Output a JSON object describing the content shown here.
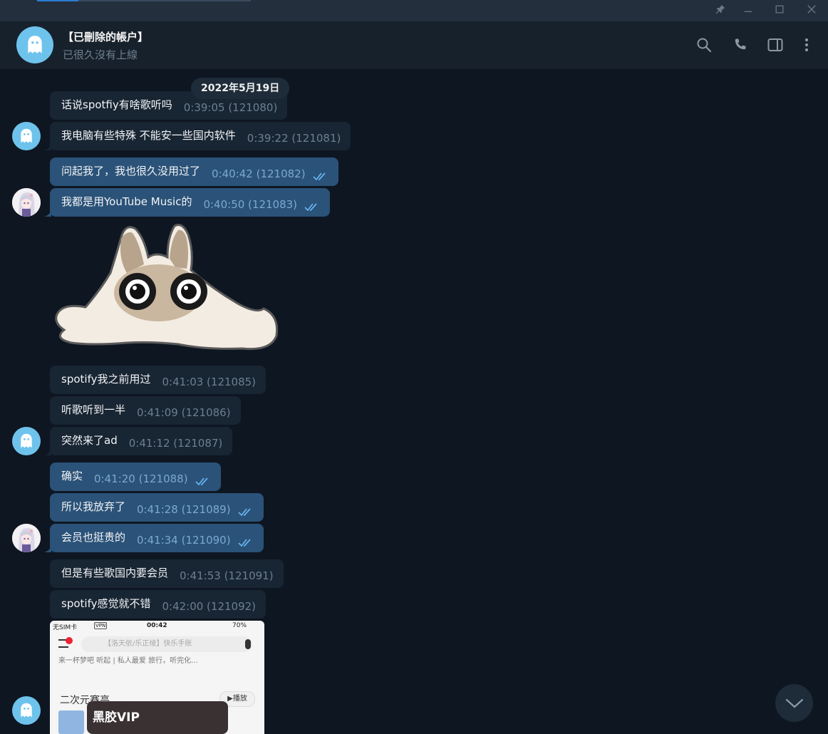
{
  "window": {
    "controls": [
      "pin-icon",
      "minimize-icon",
      "maximize-icon",
      "close-icon"
    ]
  },
  "header": {
    "title": "【已刪除的帳户】",
    "status": "已很久沒有上線",
    "icons": [
      "search-icon",
      "phone-icon",
      "sidebar-toggle-icon",
      "more-vertical-icon"
    ]
  },
  "date_label": "2022年5月19日",
  "messages": [
    {
      "dir": "in",
      "text": "话说spotfiy有啥歌听吗",
      "meta": "0:39:05 (121080)"
    },
    {
      "dir": "in",
      "text": "我电脑有些特殊 不能安一些国内软件",
      "meta": "0:39:22 (121081)"
    },
    {
      "dir": "out",
      "text": "问起我了，我也很久没用过了",
      "meta": "0:40:42 (121082)"
    },
    {
      "dir": "out",
      "text": "我都是用YouTube Music的",
      "meta": "0:40:50 (121083)"
    },
    {
      "dir": "in",
      "text": "spotify我之前用过",
      "meta": "0:41:03 (121085)"
    },
    {
      "dir": "in",
      "text": "听歌听到一半",
      "meta": "0:41:09 (121086)"
    },
    {
      "dir": "in",
      "text": "突然来了ad",
      "meta": "0:41:12 (121087)"
    },
    {
      "dir": "out",
      "text": "确实",
      "meta": "0:41:20 (121088)"
    },
    {
      "dir": "out",
      "text": "所以我放弃了",
      "meta": "0:41:28 (121089)"
    },
    {
      "dir": "out",
      "text": "会员也挺贵的",
      "meta": "0:41:34 (121090)"
    },
    {
      "dir": "in",
      "text": "但是有些歌国内要会员",
      "meta": "0:41:53 (121091)"
    },
    {
      "dir": "in",
      "text": "spotify感觉就不错",
      "meta": "0:42:00 (121092)"
    }
  ],
  "sticker": {
    "icon": "cat-blob-sticker"
  },
  "screenshot": {
    "carrier": "无SIM卡",
    "vpn": "VPN",
    "time": "00:42",
    "battery": "70%",
    "search_placeholder": "【洛天依/乐正绫】快乐手账",
    "row_text": "来一杯梦吧    听起 | 私人最爱    旅行，听完化...",
    "section_title": "二次元赛高",
    "play_label": "▶播放",
    "vip_label": "黑胶VIP"
  },
  "colors": {
    "background": "#0e1621",
    "header": "#17212b",
    "bubble_in": "#182533",
    "bubble_out": "#2b5278",
    "accent": "#6ec3ec",
    "read_ticks": "#68b4f1"
  }
}
